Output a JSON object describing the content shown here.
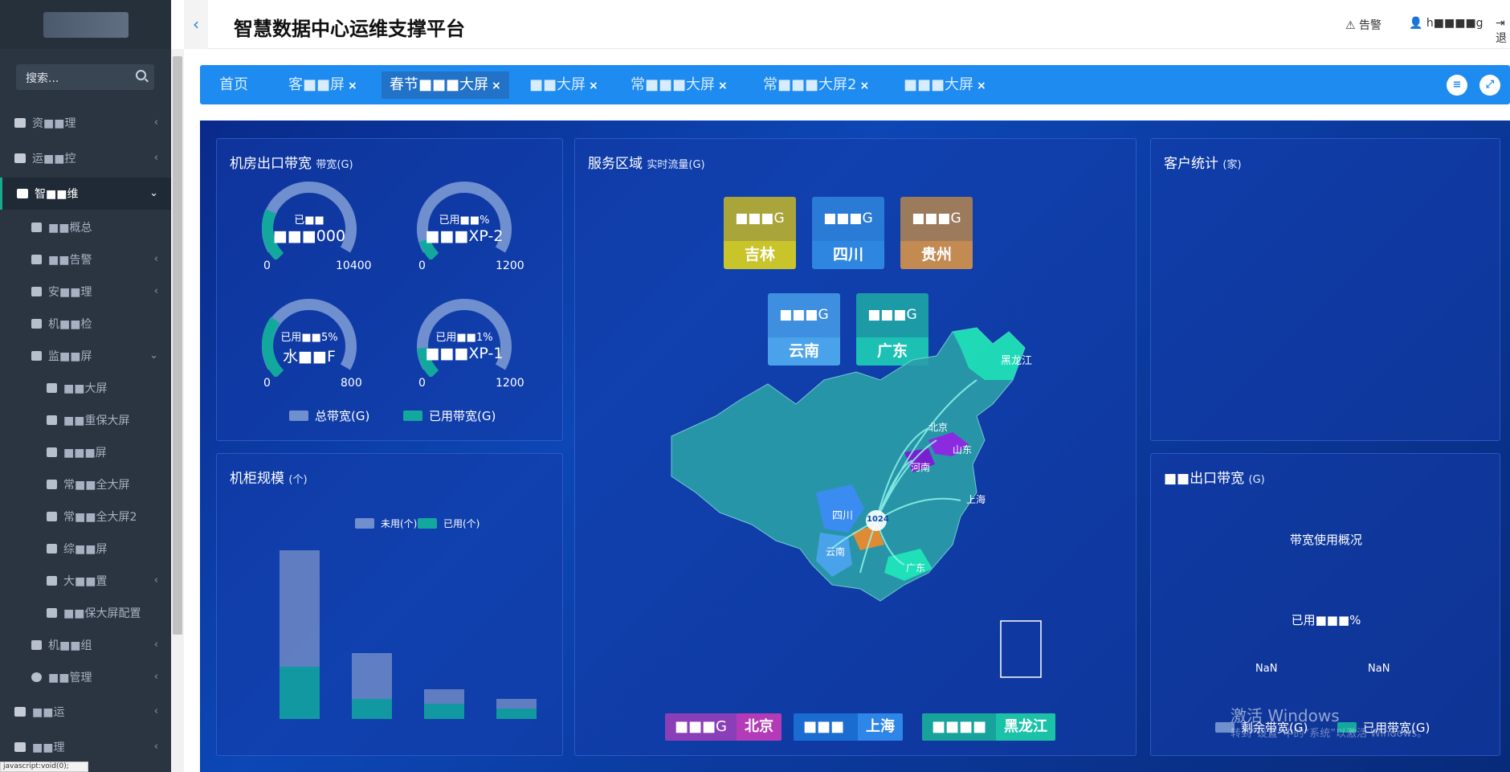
{
  "app": {
    "title": "智慧数据中心运维支撑平台"
  },
  "header": {
    "alarm": "告警",
    "user": "h■■■■g",
    "logout": "退"
  },
  "sidebar": {
    "search_placeholder": "搜索...",
    "items": [
      {
        "label": "资■■理"
      },
      {
        "label": "运■■控"
      },
      {
        "label": "智■■维"
      },
      {
        "label": "■■概总"
      },
      {
        "label": "■■告警"
      },
      {
        "label": "安■■理"
      },
      {
        "label": "机■■检"
      },
      {
        "label": "监■■屏"
      },
      {
        "label": "■■大屏"
      },
      {
        "label": "■■重保大屏"
      },
      {
        "label": "■■■屏"
      },
      {
        "label": "常■■全大屏"
      },
      {
        "label": "常■■全大屏2"
      },
      {
        "label": "综■■屏"
      },
      {
        "label": "大■■置"
      },
      {
        "label": "■■保大屏配置"
      },
      {
        "label": "机■■组"
      },
      {
        "label": "■■管理"
      },
      {
        "label": "■■运"
      },
      {
        "label": "■■理"
      }
    ],
    "status_url": "javascript:void(0);"
  },
  "tabs": [
    {
      "label": "首页"
    },
    {
      "label": "客■■屏"
    },
    {
      "label": "春节■■■大屏"
    },
    {
      "label": "■■大屏"
    },
    {
      "label": "常■■■大屏"
    },
    {
      "label": "常■■■大屏2"
    },
    {
      "label": "■■■大屏"
    }
  ],
  "panels": {
    "bandwidth": {
      "title": "机房出口带宽",
      "unit": "带宽(G)",
      "gauges": [
        {
          "line1": "已■■",
          "line2": "■■■000",
          "min": "0",
          "max": "10400",
          "used_fraction": 0.25
        },
        {
          "line1": "已用■■%",
          "line2": "■■■XP-2",
          "min": "0",
          "max": "1200",
          "used_fraction": 0.1
        },
        {
          "line1": "已用■■5%",
          "line2": "水■■F",
          "min": "0",
          "max": "800",
          "used_fraction": 0.3
        },
        {
          "line1": "已用■■1%",
          "line2": "■■■XP-1",
          "min": "0",
          "max": "1200",
          "used_fraction": 0.15
        }
      ],
      "legend": {
        "total": "总带宽(G)",
        "used": "已用带宽(G)"
      }
    },
    "cabinet": {
      "title": "机柜规模",
      "unit": "(个)",
      "legend": {
        "unused": "未用(个)",
        "used": "已用(个)"
      }
    },
    "service": {
      "title": "服务区域",
      "unit": "实时流量(G)",
      "regions": [
        {
          "value": "■■■G",
          "name": "吉林",
          "top_color": "#a9a53a",
          "bot_color": "#c8c42a"
        },
        {
          "value": "■■■G",
          "name": "四川",
          "top_color": "#2a7bd5",
          "bot_color": "#2e86e0"
        },
        {
          "value": "■■■G",
          "name": "贵州",
          "top_color": "#9c7a5c",
          "bot_color": "#c38a52"
        },
        {
          "value": "■■■G",
          "name": "云南",
          "top_color": "#3f8fe0",
          "bot_color": "#4aa3ea"
        },
        {
          "value": "■■■G",
          "name": "广东",
          "top_color": "#1c9aa6",
          "bot_color": "#1cc1b4"
        }
      ],
      "map_labels": [
        "黑龙江",
        "北京",
        "山东",
        "河南",
        "上海",
        "四川",
        "云南",
        "广东",
        "1024"
      ],
      "bottom": [
        {
          "value": "■■■G",
          "name": "北京",
          "v_color": "#8a3fb8",
          "n_color": "#b43bb8"
        },
        {
          "value": "■■■",
          "name": "上海",
          "v_color": "#1b6cd0",
          "n_color": "#2d86e8"
        },
        {
          "value": "■■■■",
          "name": "黑龙江",
          "v_color": "#17a39b",
          "n_color": "#1cc2a8"
        }
      ]
    },
    "customer": {
      "title": "客户统计",
      "unit": "(家)"
    },
    "export": {
      "title": "■■出口带宽",
      "unit": "(G)",
      "subtitle": "带宽使用概况",
      "used_label": "已用■■■%",
      "nan1": "NaN",
      "nan2": "NaN",
      "legend": {
        "remain": "剩余带宽(G)",
        "used": "已用带宽(G)"
      }
    }
  },
  "watermark": {
    "line1": "激活 Windows",
    "line2": "转到“设置”中的“系统”以激活 Windows。"
  },
  "colors": {
    "accent": "#1e8bf0",
    "sidebar": "#2b3541",
    "teal": "#19aa8d",
    "gauge_bg": "#6f8fce",
    "gauge_fill": "#13a89e"
  }
}
